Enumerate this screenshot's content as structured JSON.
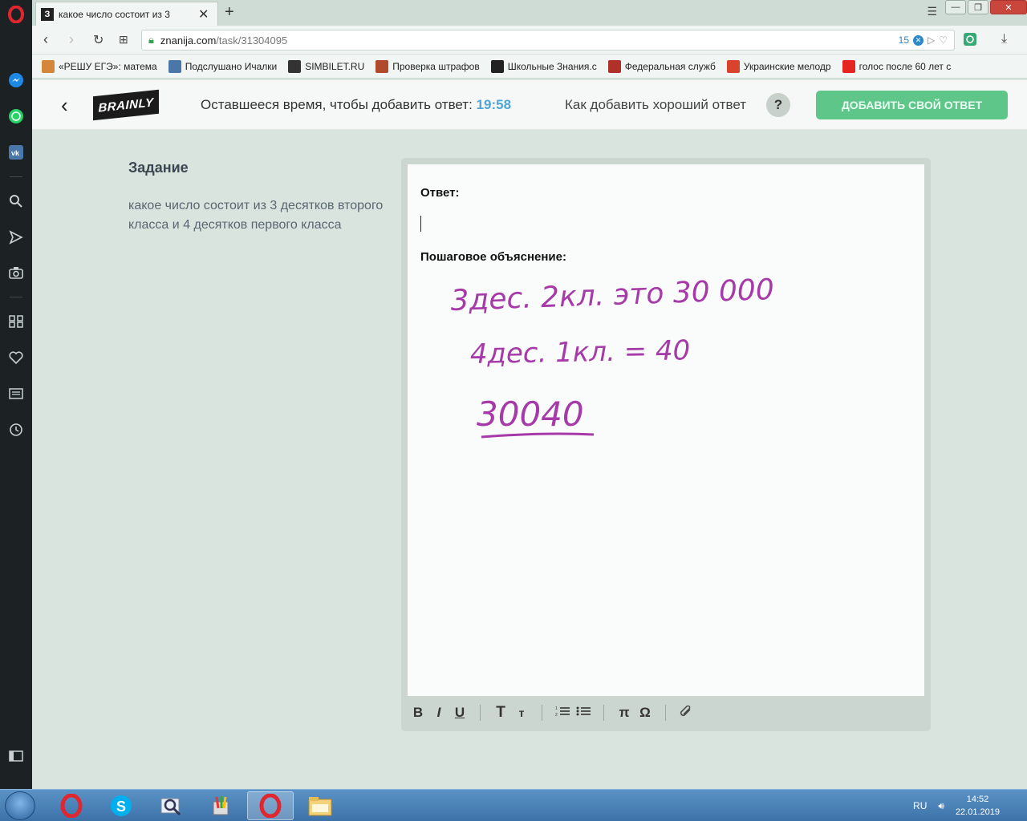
{
  "browser": {
    "tab_title": "какое число состоит из 3",
    "tab_favicon": "З",
    "url_host": "znanija.com",
    "url_path": "/task/31304095",
    "ext_badge_count": "15"
  },
  "bookmarks": [
    {
      "label": "«РЕШУ ЕГЭ»: матема",
      "icon": "sun-icon",
      "color": "#d4873a"
    },
    {
      "label": "Подслушано Ичалки",
      "icon": "vk-icon",
      "color": "#4a76a8"
    },
    {
      "label": "SIMBILET.RU",
      "icon": "sim-icon",
      "color": "#333333"
    },
    {
      "label": "Проверка штрафов",
      "icon": "emblem-icon",
      "color": "#b04a2a"
    },
    {
      "label": "Школьные Знания.c",
      "icon": "znanija-icon",
      "color": "#222222"
    },
    {
      "label": "Федеральная служб",
      "icon": "fed-icon",
      "color": "#b0302a"
    },
    {
      "label": "Украинские мелодр",
      "icon": "ua-icon",
      "color": "#d9432e"
    },
    {
      "label": "голос после 60 лет с",
      "icon": "yandex-icon",
      "color": "#e52620"
    }
  ],
  "header": {
    "logo": "BRAINLY",
    "timer_label": "Оставшееся время, чтобы добавить ответ:",
    "timer_value": "19:58",
    "howto_label": "Как добавить хороший ответ",
    "help_glyph": "?",
    "add_button": "ДОБАВИТЬ СВОЙ ОТВЕТ"
  },
  "task": {
    "heading": "Задание",
    "text": "какое число состоит из 3 десятков второго класса и 4 десятков первого класса"
  },
  "editor": {
    "answer_label": "Ответ:",
    "explanation_label": "Пошаговое объяснение:",
    "handwriting": {
      "line1": "3дес. 2кл. это 30 000",
      "line2": "4дес. 1кл. = 40",
      "line3": "30040"
    },
    "handwriting_color": "#a63aa8",
    "toolbar": {
      "bold": "B",
      "italic": "I",
      "underline": "U",
      "text_large": "T",
      "text_small": "т",
      "pi": "π",
      "omega": "Ω"
    }
  },
  "taskbar": {
    "lang": "RU",
    "time": "14:52",
    "date": "22.01.2019"
  }
}
